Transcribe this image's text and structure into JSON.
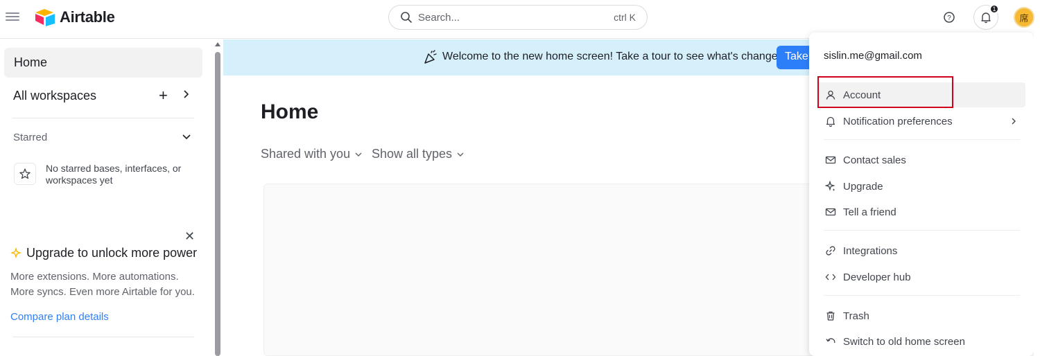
{
  "topbar": {
    "logo_text": "Airtable",
    "search_placeholder": "Search...",
    "search_shortcut": "ctrl K",
    "notification_count": "1",
    "avatar_initial": "席"
  },
  "sidebar": {
    "home_label": "Home",
    "all_workspaces_label": "All workspaces",
    "starred_label": "Starred",
    "starred_empty_text": "No starred bases, interfaces, or workspaces yet",
    "upgrade_title": "Upgrade to unlock more power",
    "upgrade_text": "More extensions. More automations. More syncs. Even more Airtable for you.",
    "compare_link": "Compare plan details"
  },
  "main": {
    "banner_text": "Welcome to the new home screen! Take a tour to see what's changed.",
    "banner_button": "Take",
    "page_title": "Home",
    "filter_shared": "Shared with you",
    "filter_types": "Show all types"
  },
  "menu": {
    "email": "sislin.me@gmail.com",
    "items": [
      {
        "label": "Account",
        "icon": "person-icon"
      },
      {
        "label": "Notification preferences",
        "icon": "bell-icon"
      },
      {
        "label": "Contact sales",
        "icon": "mail-icon"
      },
      {
        "label": "Upgrade",
        "icon": "sparkle-icon"
      },
      {
        "label": "Tell a friend",
        "icon": "mail-icon"
      },
      {
        "label": "Integrations",
        "icon": "link-icon"
      },
      {
        "label": "Developer hub",
        "icon": "code-icon"
      },
      {
        "label": "Trash",
        "icon": "trash-icon"
      },
      {
        "label": "Switch to old home screen",
        "icon": "undo-icon"
      }
    ]
  },
  "colors": {
    "accent": "#2d7ff9",
    "banner_bg": "#d6f0fb",
    "highlight_border": "#d0021b"
  }
}
